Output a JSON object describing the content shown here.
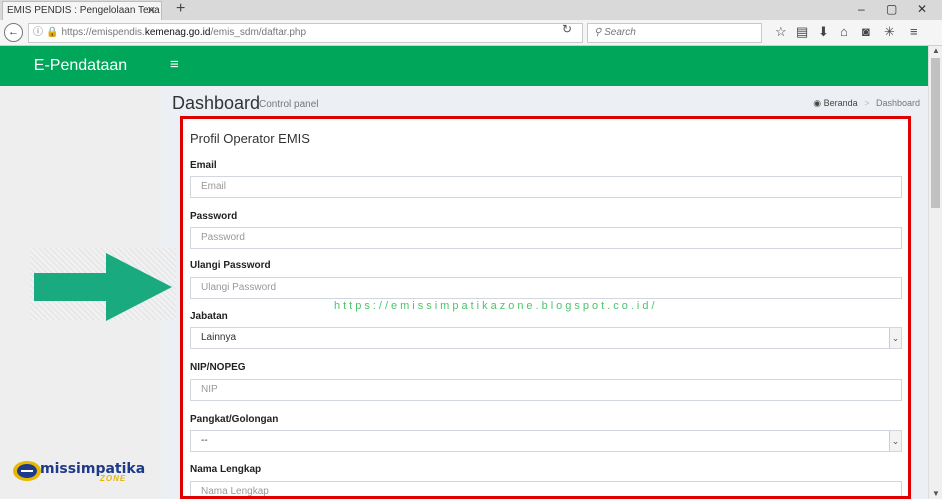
{
  "browser": {
    "tab_title": "EMIS PENDIS : Pengelolaan Tena",
    "tab_close": "✕",
    "new_tab": "+",
    "url_host_prefix": "https://emispendis.",
    "url_host": "kemenag.go.id",
    "url_path": "/emis_sdm/daftar.php",
    "search_placeholder": "Search",
    "window_controls": [
      "–",
      "▢",
      "✕"
    ]
  },
  "app": {
    "brand": "E-Pendataan",
    "menu_icon": "≡"
  },
  "page": {
    "title": "Dashboard",
    "subtitle": "Control panel",
    "breadcrumb": {
      "home": "Beranda",
      "separator": ">",
      "current": "Dashboard"
    }
  },
  "form": {
    "title": "Profil Operator EMIS",
    "fields": [
      {
        "label": "Email",
        "placeholder": "Email"
      },
      {
        "label": "Password",
        "placeholder": "Password"
      },
      {
        "label": "Ulangi Password",
        "placeholder": "Ulangi Password"
      },
      {
        "label": "Jabatan",
        "value": "Lainnya"
      },
      {
        "label": "NIP/NOPEG",
        "placeholder": "NIP"
      },
      {
        "label": "Pangkat/Golongan",
        "value": "--"
      },
      {
        "label": "Nama Lengkap",
        "placeholder": "Nama Lengkap"
      }
    ]
  },
  "watermark": "https://emissimpatikazone.blogspot.co.id/",
  "logo": {
    "main": "missimpatika",
    "sub": "ZONE"
  },
  "colors": {
    "header": "#00a65a",
    "highlight_border": "#e00000",
    "arrow": "#1aaa80"
  }
}
